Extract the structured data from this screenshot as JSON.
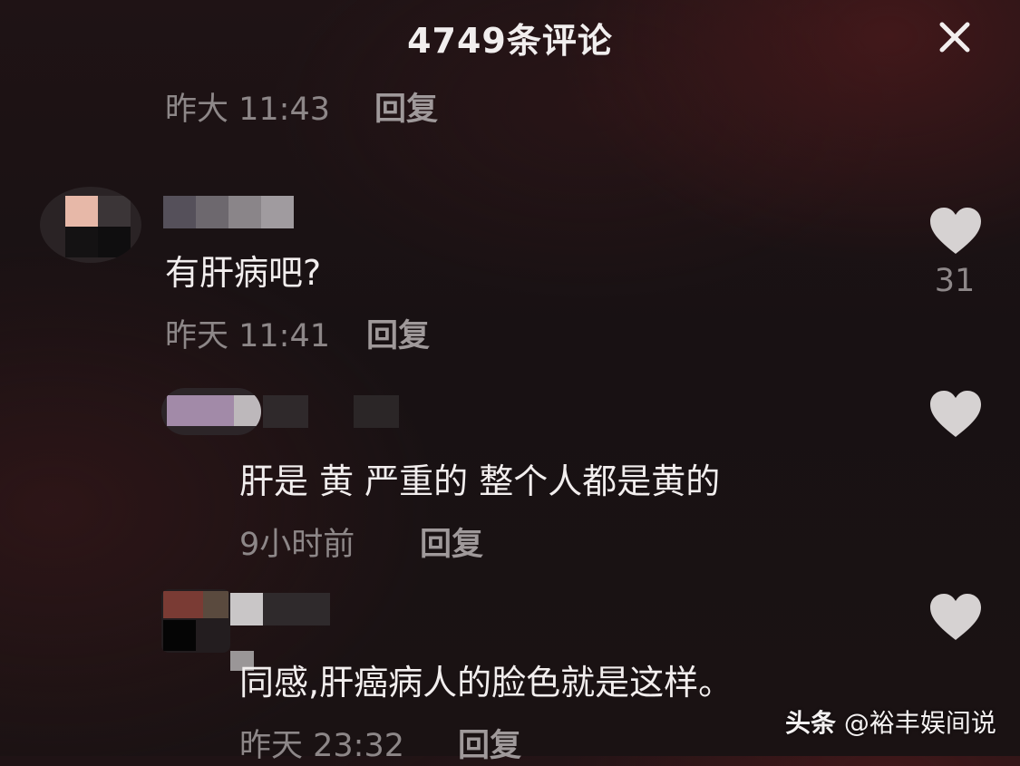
{
  "header": {
    "title": "4749条评论"
  },
  "comments": [
    {
      "time": "昨大 11:43",
      "reply_label": "回复"
    },
    {
      "text": "有肝病吧?",
      "time": "昨天 11:41",
      "reply_label": "回复",
      "like_count": "31"
    },
    {
      "text": "肝是 黄 严重的 整个人都是黄的",
      "time": "9小时前",
      "reply_label": "回复"
    },
    {
      "text": "同感,肝癌病人的脸色就是这样。",
      "time": "昨天 23:32",
      "reply_label": "回复"
    }
  ],
  "icons": {
    "close": "close-icon",
    "like": "heart-icon"
  },
  "watermark": {
    "brand": "头条",
    "handle": "@裕丰娱间说"
  },
  "colors": {
    "background": "#1a1213",
    "text_primary": "#f2eeee",
    "text_meta": "#8d8788",
    "heart": "#d6d2d2"
  }
}
